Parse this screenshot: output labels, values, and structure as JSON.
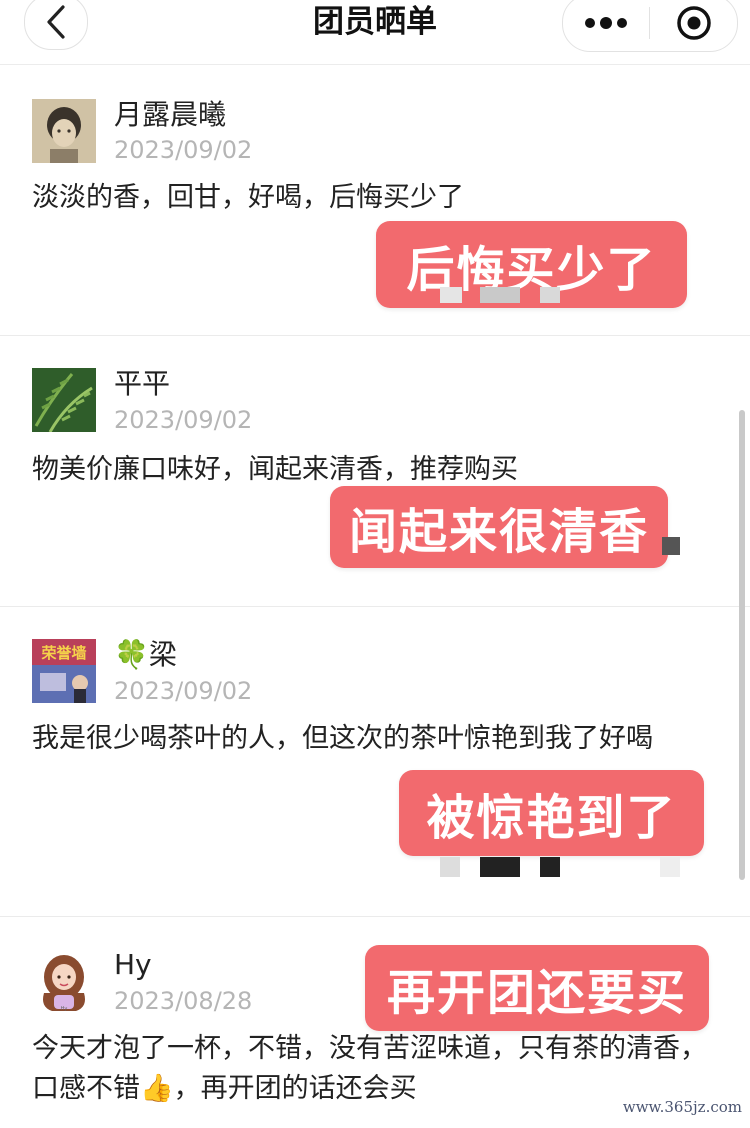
{
  "header": {
    "title": "团员晒单",
    "back_icon": "chevron-left-icon",
    "more_icon": "more-dots-icon",
    "close_icon": "target-circle-icon"
  },
  "reviews": [
    {
      "name": "月露晨曦",
      "date": "2023/09/02",
      "text": "淡淡的香，回甘，好喝，后悔买少了",
      "sticker": "后悔买少了",
      "avatar": "avatar-girl-portrait"
    },
    {
      "name": "平平",
      "date": "2023/09/02",
      "text": "物美价廉口味好，闻起来清香，推荐购买",
      "sticker": "闻起来很清香",
      "avatar": "avatar-fern-leaves"
    },
    {
      "name": "🍀梁",
      "date": "2023/09/02",
      "text": "我是很少喝茶叶的人，但这次的茶叶惊艳到我了好喝",
      "sticker": "被惊艳到了",
      "avatar": "avatar-honor-poster"
    },
    {
      "name": "Hy",
      "date": "2023/08/28",
      "text": "今天才泡了一杯，不错，没有苦涩味道，只有茶的清香，口感不错👍，再开团的话还会买",
      "sticker": "再开团还要买",
      "avatar": "avatar-cartoon-girl"
    }
  ],
  "avatar_4_caption": "Hy",
  "avatar_3_caption": "荣誉墙",
  "watermark": "www.365jz.com",
  "colors": {
    "sticker_bg": "#f26a6e",
    "date_gray": "#b5b5b5"
  }
}
